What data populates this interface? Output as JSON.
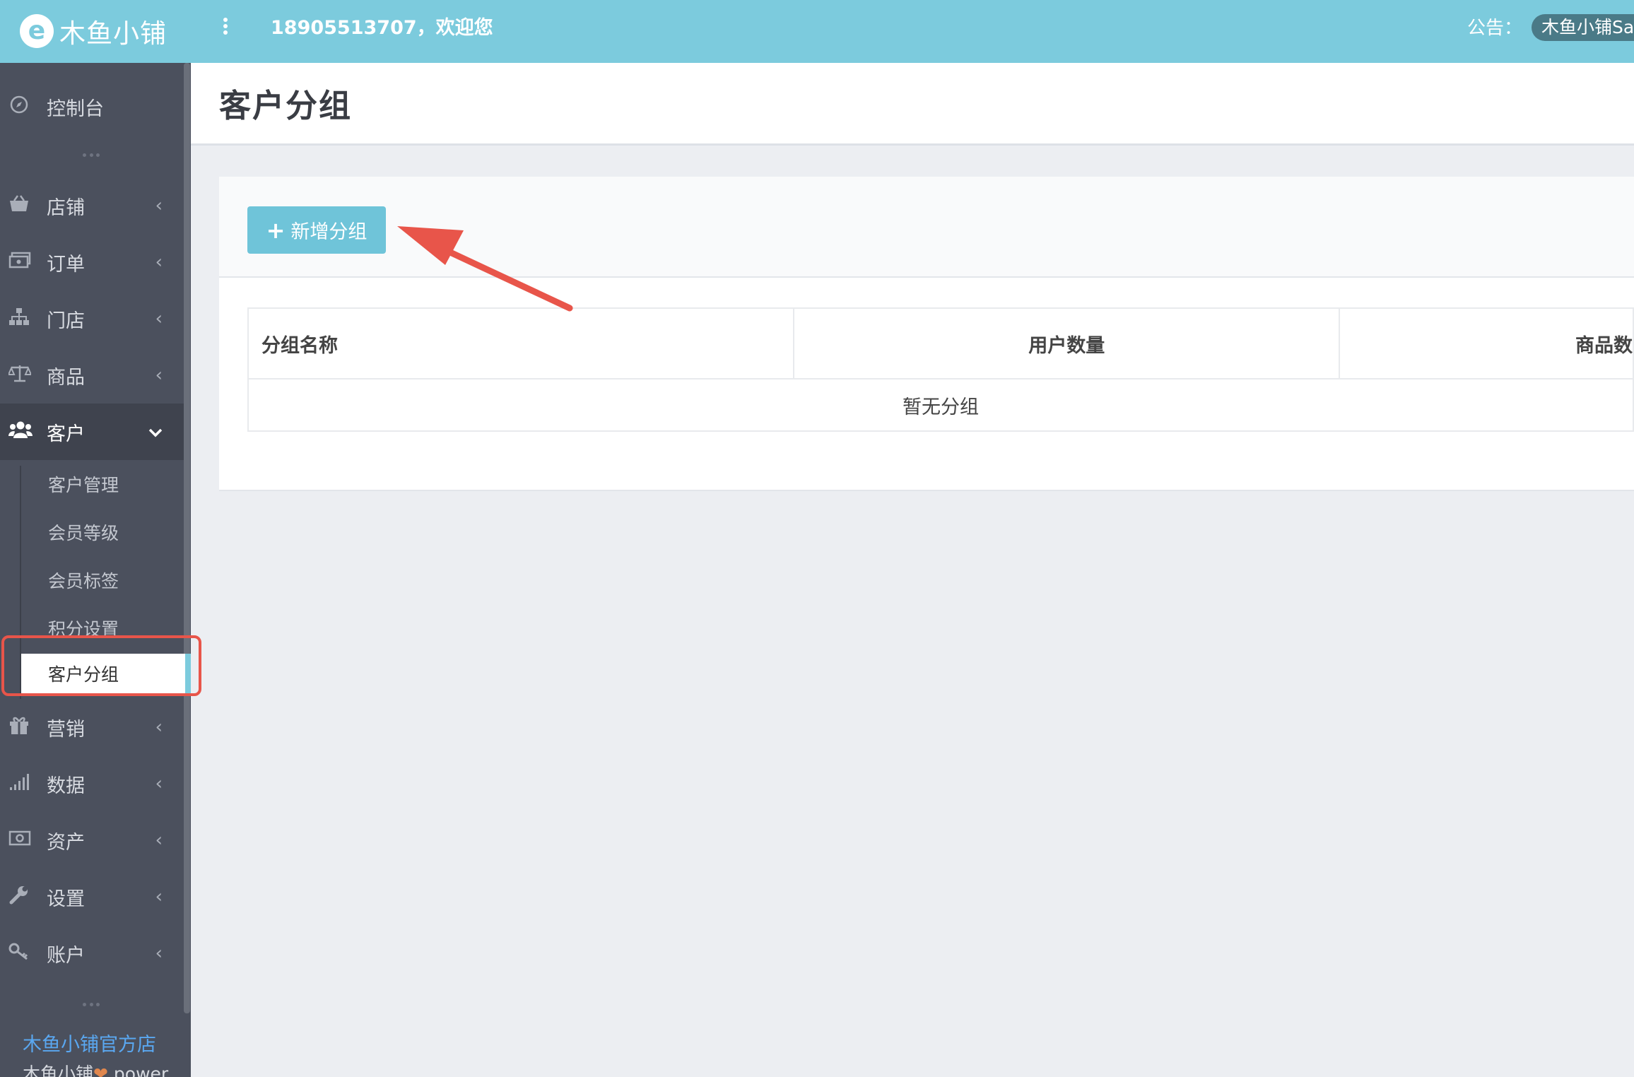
{
  "header": {
    "logo_glyph": "e",
    "logo_text": "木鱼小铺",
    "welcome": "18905513707，欢迎您",
    "notice_label": "公告：",
    "notice_text": "木鱼小铺Sa"
  },
  "sidebar": {
    "items": [
      {
        "label": "控制台",
        "icon": "compass-icon"
      },
      {
        "label": "店铺",
        "icon": "basket-icon"
      },
      {
        "label": "订单",
        "icon": "money-icon"
      },
      {
        "label": "门店",
        "icon": "sitemap-icon"
      },
      {
        "label": "商品",
        "icon": "balance-icon"
      },
      {
        "label": "客户",
        "icon": "users-icon"
      },
      {
        "label": "营销",
        "icon": "gift-icon"
      },
      {
        "label": "数据",
        "icon": "signal-icon"
      },
      {
        "label": "资产",
        "icon": "banknote-icon"
      },
      {
        "label": "设置",
        "icon": "wrench-icon"
      },
      {
        "label": "账户",
        "icon": "key-icon"
      }
    ],
    "sub_items": [
      "客户管理",
      "会员等级",
      "会员标签",
      "积分设置",
      "客户分组"
    ],
    "active_item": "客户",
    "active_sub_item": "客户分组",
    "official_link": "木鱼小铺官方店",
    "power_prefix": "木鱼小铺",
    "power_suffix": " power"
  },
  "main": {
    "page_title": "客户分组",
    "add_button_label": "新增分组",
    "table": {
      "columns": [
        "分组名称",
        "用户数量",
        "商品数"
      ],
      "empty_text": "暂无分组"
    }
  },
  "colors": {
    "accent": "#7ccbdd",
    "sidebar_bg": "#4b505d",
    "annotation": "#e8554a"
  }
}
